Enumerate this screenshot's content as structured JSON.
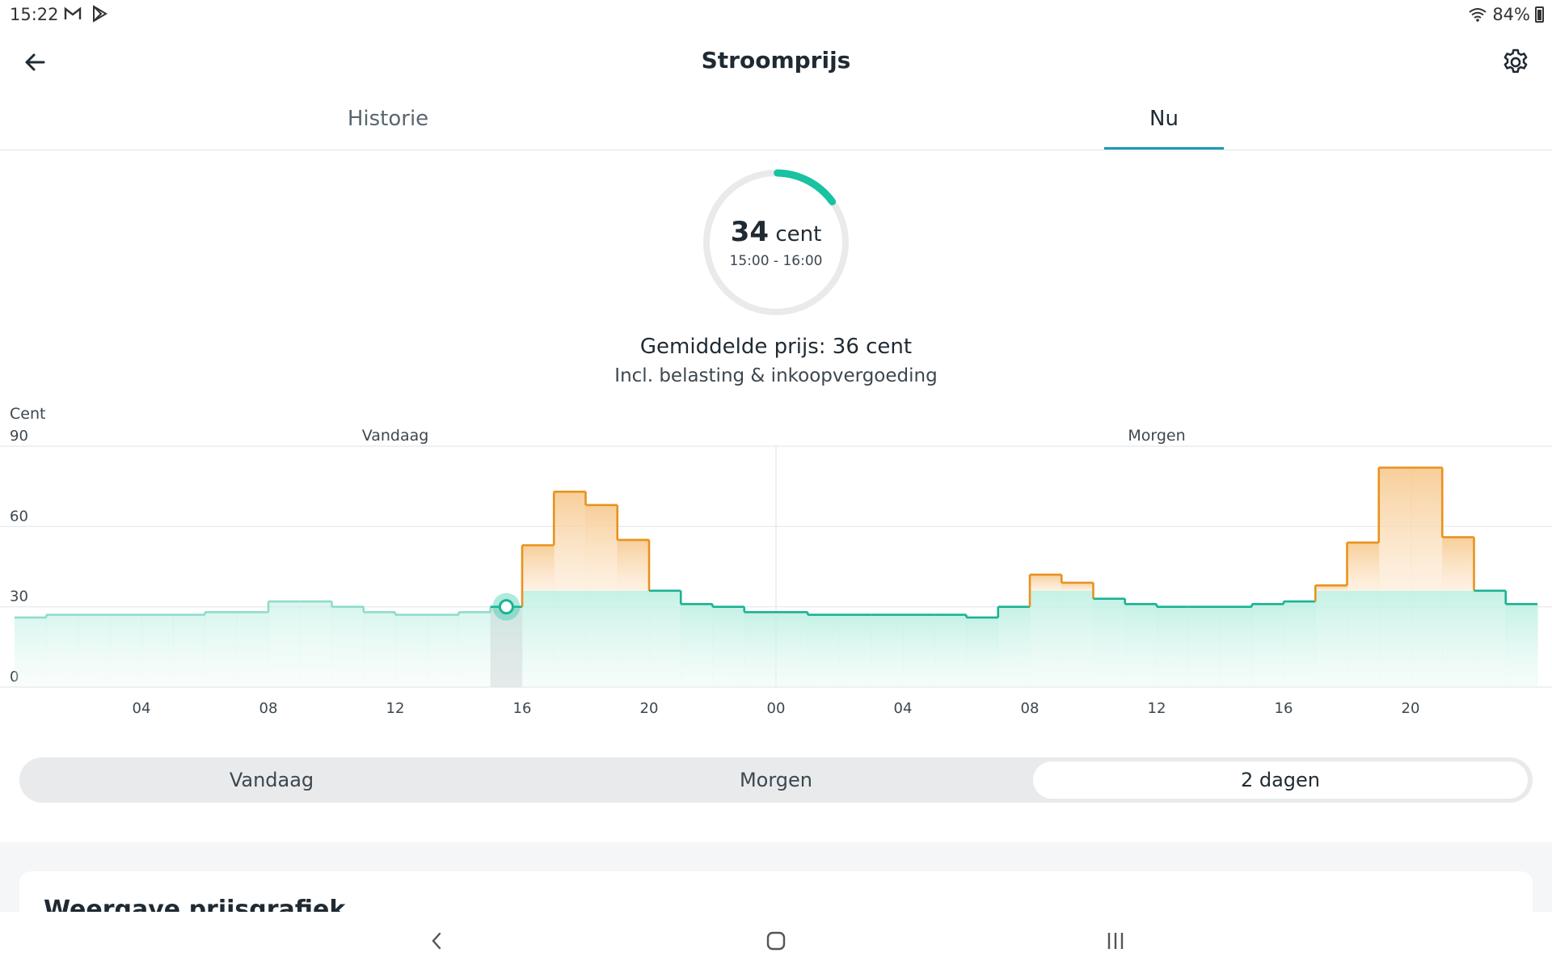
{
  "status_bar": {
    "time": "15:22",
    "battery": "84%",
    "left_icons": [
      "mail-icon",
      "play-store-icon"
    ]
  },
  "header": {
    "title": "Stroomprijs"
  },
  "tabs": [
    {
      "label": "Historie",
      "active": false
    },
    {
      "label": "Nu",
      "active": true
    }
  ],
  "current": {
    "price": "34",
    "unit": "cent",
    "time_range": "15:00 - 16:00",
    "gauge_fraction": 0.15
  },
  "summary": {
    "average": "Gemiddelde prijs: 36 cent",
    "note": "Incl. belasting & inkoopvergoeding"
  },
  "chart_data": {
    "type": "line",
    "step": true,
    "ylabel": "Cent",
    "ylim": [
      0,
      90
    ],
    "yticks": [
      "90",
      "60",
      "30",
      "0"
    ],
    "day_labels": [
      "Vandaag",
      "Morgen"
    ],
    "xticks": [
      "04",
      "08",
      "12",
      "16",
      "20",
      "00",
      "04",
      "08",
      "12",
      "16",
      "20"
    ],
    "threshold": 36,
    "current_hour_index": 15,
    "colors": {
      "low": "#19b394",
      "low_past": "#8fdccb",
      "high": "#e8921e"
    },
    "hours": [
      0,
      1,
      2,
      3,
      4,
      5,
      6,
      7,
      8,
      9,
      10,
      11,
      12,
      13,
      14,
      15,
      16,
      17,
      18,
      19,
      20,
      21,
      22,
      23,
      24,
      25,
      26,
      27,
      28,
      29,
      30,
      31,
      32,
      33,
      34,
      35,
      36,
      37,
      38,
      39,
      40,
      41,
      42,
      43,
      44,
      45,
      46,
      47
    ],
    "values": [
      26,
      27,
      27,
      27,
      27,
      27,
      28,
      28,
      32,
      32,
      30,
      28,
      27,
      27,
      28,
      30,
      53,
      73,
      68,
      55,
      36,
      31,
      30,
      28,
      28,
      27,
      27,
      27,
      27,
      27,
      26,
      30,
      42,
      39,
      33,
      31,
      30,
      30,
      30,
      31,
      32,
      38,
      54,
      82,
      82,
      56,
      36,
      31
    ]
  },
  "range_selector": {
    "options": [
      "Vandaag",
      "Morgen",
      "2 dagen"
    ],
    "selected": "2 dagen"
  },
  "section": {
    "title": "Weergave prijsgrafiek"
  }
}
